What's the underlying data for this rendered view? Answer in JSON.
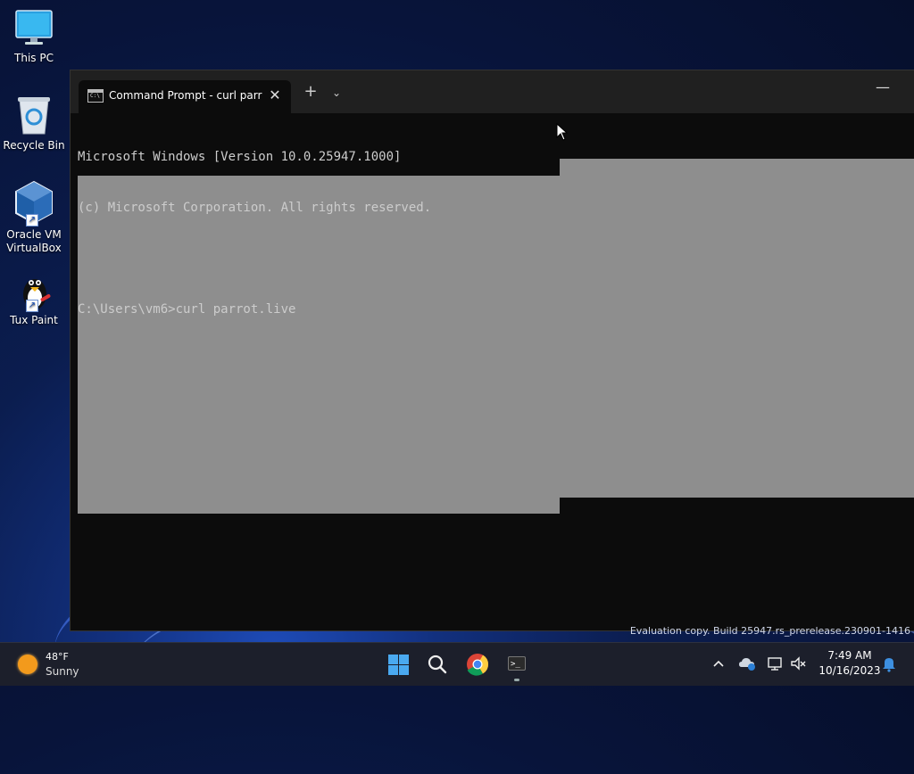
{
  "desktop": {
    "icons": [
      {
        "label": "This PC",
        "icon": "monitor-icon"
      },
      {
        "label": "Recycle Bin",
        "icon": "recycle-bin-icon"
      },
      {
        "label": "Oracle VM VirtualBox",
        "icon": "virtualbox-icon"
      },
      {
        "label": "Tux Paint",
        "icon": "tux-paint-icon"
      }
    ],
    "watermark": "Evaluation copy. Build 25947.rs_prerelease.230901-1416"
  },
  "terminal": {
    "tab_title": "Command Prompt - curl  parr",
    "tab_icon_glyph": "C:\\",
    "close_glyph": "✕",
    "new_tab_glyph": "+",
    "dropdown_glyph": "⌄",
    "minimize_glyph": "—",
    "lines": [
      "Microsoft Windows [Version 10.0.25947.1000]",
      "(c) Microsoft Corporation. All rights reserved.",
      "",
      "C:\\Users\\vm6>curl parrot.live"
    ],
    "colors": {
      "background": "#0c0c0c",
      "text": "#cccccc",
      "block": "#8e8e8e"
    }
  },
  "taskbar": {
    "weather": {
      "temp": "48°F",
      "condition": "Sunny",
      "icon": "sun-icon"
    },
    "apps": [
      {
        "name": "Start",
        "icon": "windows-start-icon"
      },
      {
        "name": "Search",
        "icon": "search-icon"
      },
      {
        "name": "Google Chrome",
        "icon": "chrome-icon"
      },
      {
        "name": "Terminal",
        "icon": "terminal-icon",
        "glyph": ">_"
      }
    ],
    "tray": {
      "chevron": "^",
      "time": "7:49 AM",
      "date": "10/16/2023"
    }
  }
}
